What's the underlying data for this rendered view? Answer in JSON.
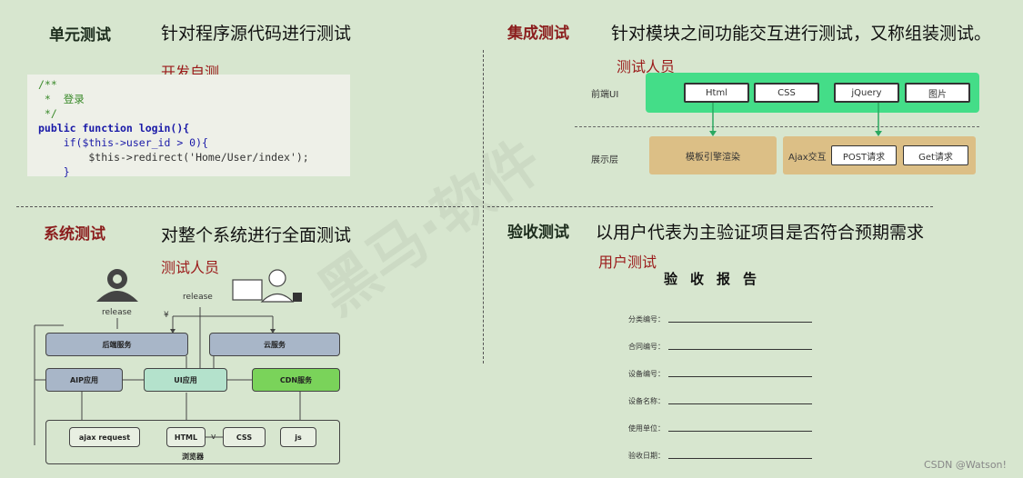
{
  "unit": {
    "title": "单元测试",
    "desc": "针对程序源代码进行测试",
    "subtitle": "开发自测",
    "code_lines": [
      "/**",
      " *  登录",
      " */",
      "public function login(){",
      "    if($this->user_id > 0){",
      "        $this->redirect('Home/User/index');",
      "    }"
    ]
  },
  "integration": {
    "title": "集成测试",
    "desc": "针对模块之间功能交互进行测试，又称组装测试。",
    "subtitle": "测试人员",
    "frontend_label": "前端UI",
    "frontend_items": [
      "Html",
      "CSS",
      "jQuery",
      "图片"
    ],
    "display_label": "展示层",
    "template_label": "模板引擎渲染",
    "ajax_label": "Ajax交互",
    "ajax_items": [
      "POST请求",
      "Get请求"
    ]
  },
  "system": {
    "title": "系统测试",
    "desc": "对整个系统进行全面测试",
    "subtitle": "测试人员",
    "release_left": "release",
    "release_right": "release",
    "yen": "¥",
    "backend": "后端服务",
    "cloud": "云服务",
    "aip": "AIP应用",
    "ui": "UI应用",
    "cdn": "CDN服务",
    "browser_items": [
      "ajax request",
      "HTML",
      "CSS",
      "js"
    ],
    "browser_label": "浏览器",
    "v_mark": "v"
  },
  "acceptance": {
    "title": "验收测试",
    "desc": "以用户代表为主验证项目是否符合预期需求",
    "subtitle": "用户测试",
    "report_title": "验收报告",
    "fields": [
      "分类编号：",
      "合同编号：",
      "设备编号：",
      "设备名称：",
      "使用单位：",
      "验收日期："
    ]
  },
  "watermark": "黑马·软件",
  "credit": "CSDN @Watson!"
}
